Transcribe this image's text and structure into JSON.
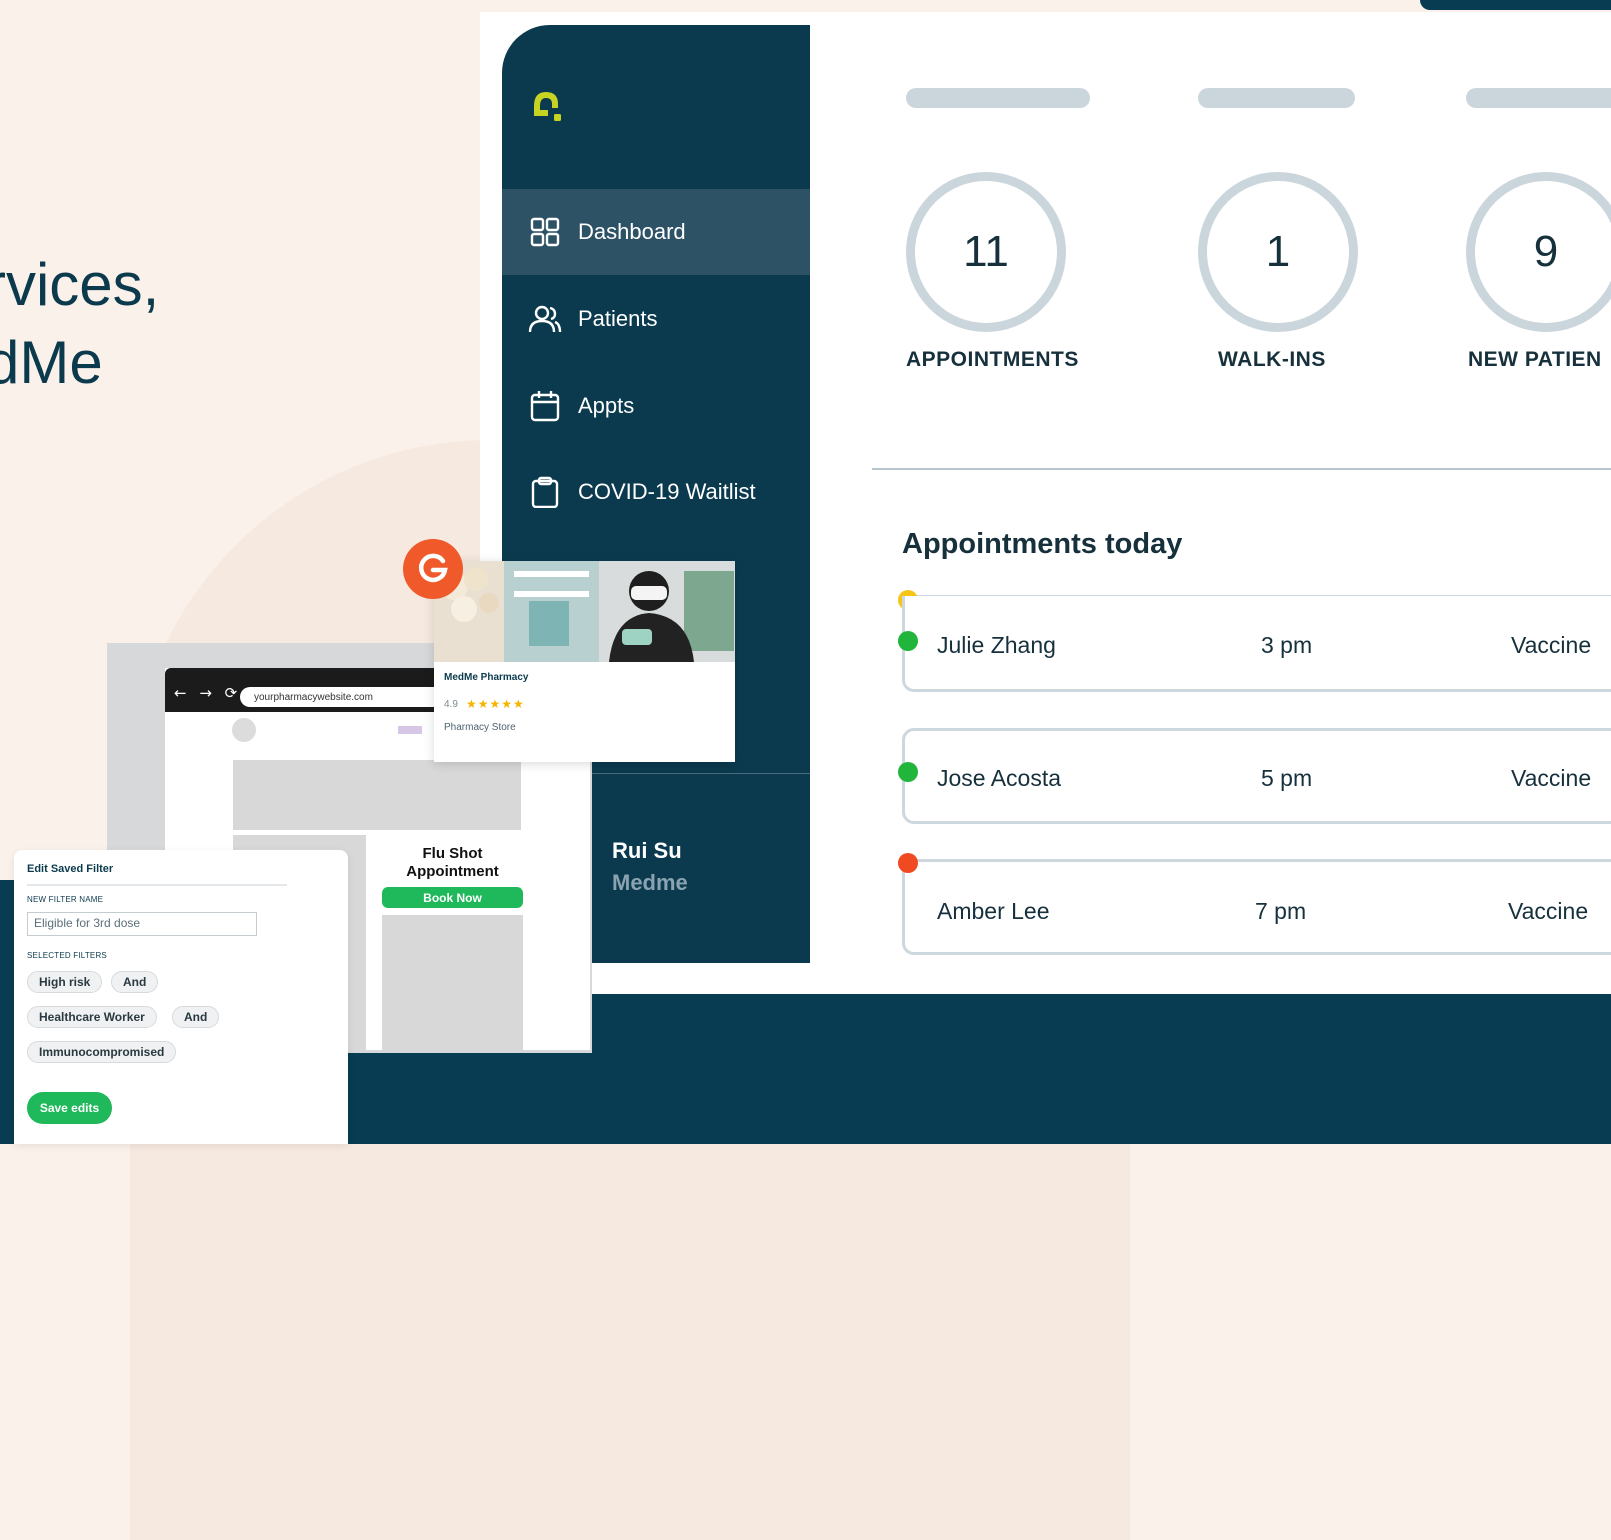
{
  "hero": {
    "text": "rvices,\ndMe"
  },
  "sidebar": {
    "logo_icon": "medme-logo-icon",
    "items": [
      {
        "label": "Dashboard",
        "icon": "grid-icon",
        "active": true
      },
      {
        "label": "Patients",
        "icon": "users-icon",
        "active": false
      },
      {
        "label": "Appts",
        "icon": "calendar-icon",
        "active": false
      },
      {
        "label": "COVID-19 Waitlist",
        "icon": "clipboard-icon",
        "active": false
      }
    ],
    "user": {
      "name": "Rui Su",
      "org": "Medme"
    }
  },
  "stats": [
    {
      "value": "11",
      "label": "APPOINTMENTS"
    },
    {
      "value": "1",
      "label": "WALK-INS"
    },
    {
      "value": "9",
      "label": "NEW PATIEN"
    }
  ],
  "appointments": {
    "heading": "Appointments today",
    "rows": [
      {
        "name": "Julie Zhang",
        "time": "3 pm",
        "type": "Vaccine",
        "status_color": "#22b53c"
      },
      {
        "name": "Jose Acosta",
        "time": "5 pm",
        "type": "Vaccine",
        "status_color": "#22b53c"
      },
      {
        "name": "Amber Lee",
        "time": "7 pm",
        "type": "Vaccine",
        "status_color": "#f04a23"
      }
    ],
    "top_marker_color": "#f5c518"
  },
  "browser": {
    "url": "yourpharmacywebsite.com",
    "nav_glyphs": "← → ⟳",
    "widget_title": "Flu Shot Appointment",
    "book_label": "Book Now"
  },
  "store": {
    "name": "MedMe Pharmacy",
    "rating": "4.9",
    "stars": "★★★★★",
    "type": "Pharmacy Store",
    "badge_icon": "google-g-icon"
  },
  "filter": {
    "title": "Edit Saved Filter",
    "name_label": "NEW FILTER NAME",
    "name_value": "Eligible for 3rd dose",
    "selected_label": "SELECTED FILTERS",
    "chips": [
      "High risk",
      "And",
      "Healthcare Worker",
      "And",
      "Immunocompromised"
    ],
    "save_label": "Save edits"
  },
  "colors": {
    "navy": "#0b3a4e",
    "accent_green": "#1fb85a",
    "logo": "#c8d422"
  }
}
